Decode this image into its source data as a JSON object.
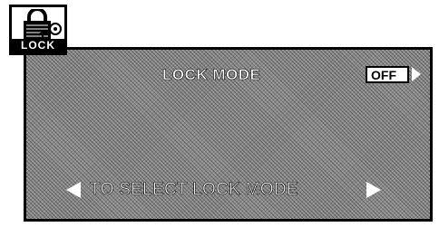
{
  "badge": {
    "label": "LOCK",
    "icon": "padlock-with-key-icon"
  },
  "screen": {
    "title": "LOCK MODE",
    "status": "OFF",
    "status_arrow_icon": "triangle-right-icon",
    "instruction": "TO SELECT LOCK MODE",
    "left_arrow_icon": "triangle-left-icon",
    "right_arrow_icon": "triangle-right-icon"
  }
}
